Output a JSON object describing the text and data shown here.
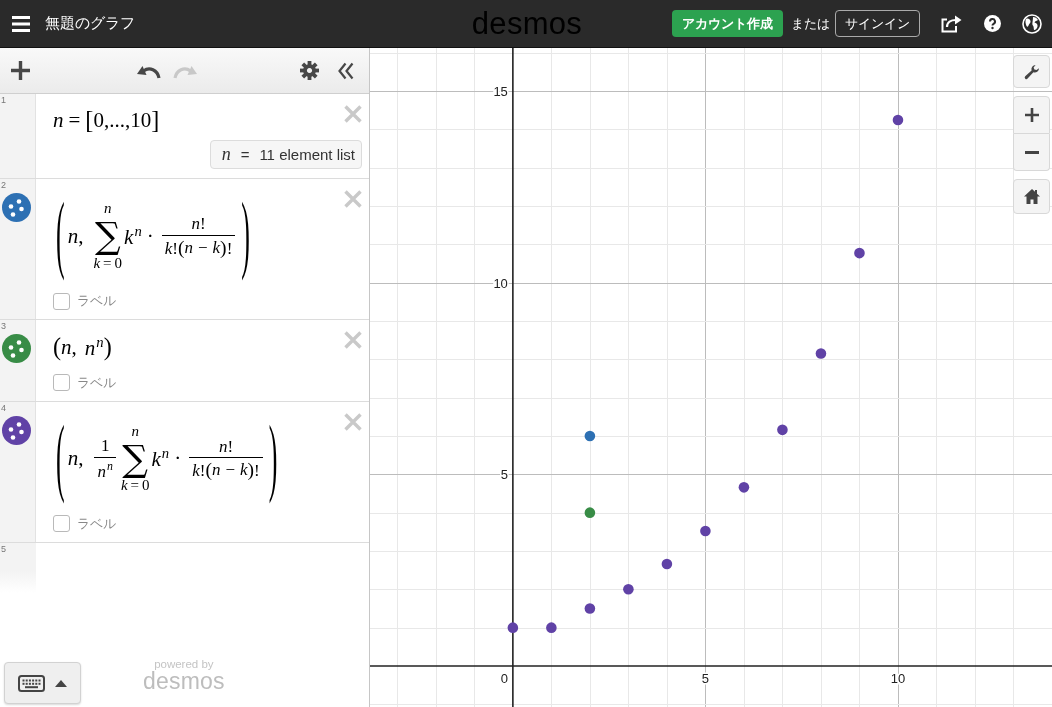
{
  "top_bar": {
    "title": "無題のグラフ",
    "logo": "desmos",
    "create_account_button": "アカウント作成",
    "or_text": "または",
    "sign_in_button": "サインイン"
  },
  "toolbar": {
    "left": [
      {
        "kind": "add",
        "disabled": false
      }
    ],
    "center": [
      {
        "kind": "undo",
        "disabled": false
      },
      {
        "kind": "redo",
        "disabled": true
      }
    ],
    "right": [
      {
        "kind": "settings",
        "disabled": false
      },
      {
        "kind": "collapse",
        "disabled": false
      }
    ]
  },
  "expressions": [
    {
      "number": "1",
      "formula": [
        {
          "kind": "var",
          "text": "n"
        },
        {
          "kind": "op",
          "text": "="
        },
        {
          "kind": "group",
          "open": "[",
          "close": "]",
          "children": [
            {
              "kind": "num",
              "text": "0,...,10"
            }
          ]
        }
      ],
      "evaluation": {
        "variable": "n",
        "operator": "=",
        "value": "11 element list"
      }
    },
    {
      "number": "2",
      "color": "#2d70b3",
      "formula": [
        {
          "kind": "group",
          "open": "(",
          "close": ")",
          "children": [
            {
              "kind": "var",
              "text": "n"
            },
            {
              "kind": "punct",
              "text": ","
            },
            {
              "kind": "sum",
              "symbol": "∑",
              "upper": [
                {
                  "kind": "var",
                  "text": "n"
                }
              ],
              "lower": [
                {
                  "kind": "var",
                  "text": "k"
                },
                {
                  "kind": "op",
                  "text": "="
                },
                {
                  "kind": "num",
                  "text": "0"
                }
              ]
            },
            {
              "kind": "sup",
              "base": [
                {
                  "kind": "var",
                  "text": "k"
                }
              ],
              "exp": [
                {
                  "kind": "var",
                  "text": "n"
                }
              ]
            },
            {
              "kind": "op",
              "text": "·"
            },
            {
              "kind": "frac",
              "num": [
                {
                  "kind": "var",
                  "text": "n"
                },
                {
                  "kind": "num",
                  "text": "!"
                }
              ],
              "den": [
                {
                  "kind": "var",
                  "text": "k"
                },
                {
                  "kind": "num",
                  "text": "!"
                },
                {
                  "kind": "group",
                  "open": "(",
                  "close": ")",
                  "children": [
                    {
                      "kind": "var",
                      "text": "n"
                    },
                    {
                      "kind": "op",
                      "text": "−"
                    },
                    {
                      "kind": "var",
                      "text": "k"
                    }
                  ]
                },
                {
                  "kind": "num",
                  "text": "!"
                }
              ]
            }
          ]
        }
      ],
      "label": {
        "text": "ラベル",
        "checked": false
      }
    },
    {
      "number": "3",
      "color": "#388c46",
      "formula": [
        {
          "kind": "group",
          "open": "(",
          "close": ")",
          "children": [
            {
              "kind": "var",
              "text": "n"
            },
            {
              "kind": "punct",
              "text": ","
            },
            {
              "kind": "sup",
              "base": [
                {
                  "kind": "var",
                  "text": "n"
                }
              ],
              "exp": [
                {
                  "kind": "var",
                  "text": "n"
                }
              ]
            }
          ]
        }
      ],
      "label": {
        "text": "ラベル",
        "checked": false
      }
    },
    {
      "number": "4",
      "color": "#6042a6",
      "formula": [
        {
          "kind": "group",
          "open": "(",
          "close": ")",
          "children": [
            {
              "kind": "var",
              "text": "n"
            },
            {
              "kind": "punct",
              "text": ","
            },
            {
              "kind": "frac",
              "num": [
                {
                  "kind": "num",
                  "text": "1"
                }
              ],
              "den": [
                {
                  "kind": "sup",
                  "base": [
                    {
                      "kind": "var",
                      "text": "n"
                    }
                  ],
                  "exp": [
                    {
                      "kind": "var",
                      "text": "n"
                    }
                  ]
                }
              ]
            },
            {
              "kind": "sum",
              "symbol": "∑",
              "upper": [
                {
                  "kind": "var",
                  "text": "n"
                }
              ],
              "lower": [
                {
                  "kind": "var",
                  "text": "k"
                },
                {
                  "kind": "op",
                  "text": "="
                },
                {
                  "kind": "num",
                  "text": "0"
                }
              ]
            },
            {
              "kind": "sup",
              "base": [
                {
                  "kind": "var",
                  "text": "k"
                }
              ],
              "exp": [
                {
                  "kind": "var",
                  "text": "n"
                }
              ]
            },
            {
              "kind": "op",
              "text": "·"
            },
            {
              "kind": "frac",
              "num": [
                {
                  "kind": "var",
                  "text": "n"
                },
                {
                  "kind": "num",
                  "text": "!"
                }
              ],
              "den": [
                {
                  "kind": "var",
                  "text": "k"
                },
                {
                  "kind": "num",
                  "text": "!"
                },
                {
                  "kind": "group",
                  "open": "(",
                  "close": ")",
                  "children": [
                    {
                      "kind": "var",
                      "text": "n"
                    },
                    {
                      "kind": "op",
                      "text": "−"
                    },
                    {
                      "kind": "var",
                      "text": "k"
                    }
                  ]
                },
                {
                  "kind": "num",
                  "text": "!"
                }
              ]
            }
          ]
        }
      ],
      "label": {
        "text": "ラベル",
        "checked": false
      }
    },
    {
      "number": "5"
    }
  ],
  "footer": {
    "powered_by": "powered by",
    "logo": "desmos"
  },
  "graph": {
    "chart_data": {
      "type": "scatter",
      "marker": "circle",
      "grid": true,
      "xlim": [
        -3.71,
        14
      ],
      "ylim": [
        -1.07,
        16.12
      ],
      "xticks": [
        0,
        5,
        10
      ],
      "yticks": [
        5,
        10,
        15
      ],
      "series": [
        {
          "color": "#2d70b3",
          "x": [
            2
          ],
          "values": [
            6
          ]
        },
        {
          "color": "#388c46",
          "x": [
            2
          ],
          "values": [
            4
          ]
        },
        {
          "color": "#6042a6",
          "x": [
            0,
            1,
            2,
            3,
            4,
            5,
            6,
            7,
            8,
            9,
            10
          ],
          "values": [
            1,
            1,
            1.5,
            2,
            2.66,
            3.52,
            4.66,
            6.16,
            8.15,
            10.77,
            14.24
          ]
        }
      ]
    }
  }
}
